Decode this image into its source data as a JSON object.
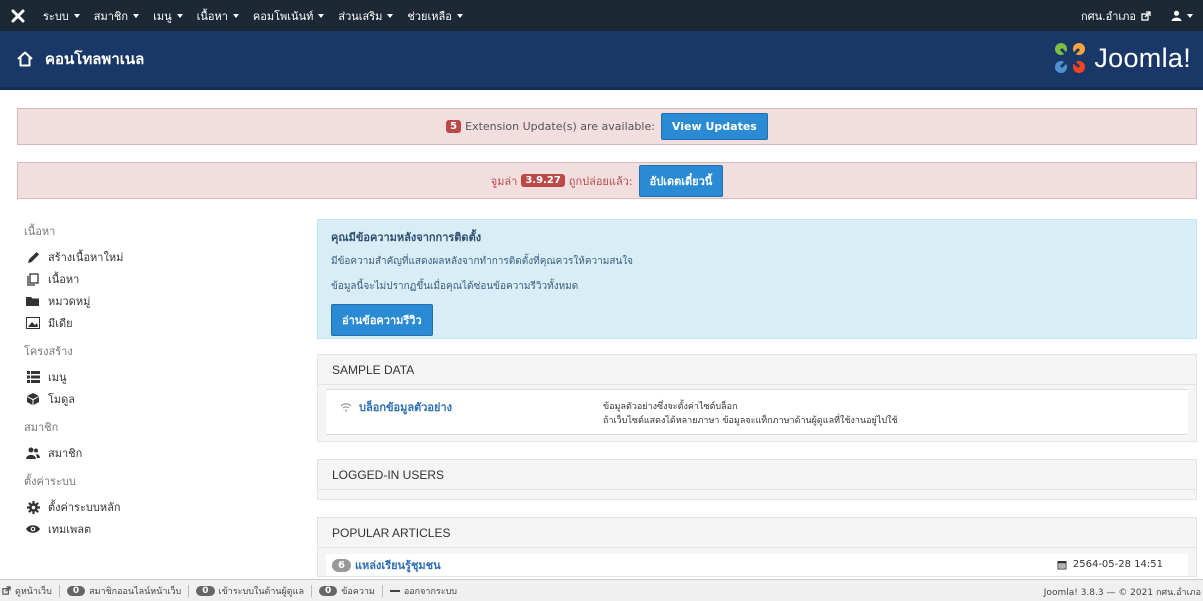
{
  "nav": {
    "menu": [
      {
        "label": "ระบบ"
      },
      {
        "label": "สมาชิก"
      },
      {
        "label": "เมนู"
      },
      {
        "label": "เนื้อหา"
      },
      {
        "label": "คอมโพเน้นท์"
      },
      {
        "label": "ส่วนเสริม"
      },
      {
        "label": "ช่วยเหลือ"
      }
    ],
    "site_link": "กศน.อำเภอ"
  },
  "header": {
    "title": "คอนโทลพาเนล",
    "brand": "Joomla!"
  },
  "alerts": {
    "extension": {
      "count": "5",
      "text": "Extension Update(s) are available:",
      "button": "View Updates"
    },
    "joomla": {
      "prefix": "จูมล่า",
      "version": "3.9.27",
      "suffix": "ถูกปล่อยแล้ว:",
      "button": "อัปเดตเดี๋ยวนี้"
    }
  },
  "sidebar": {
    "content_heading": "เนื้อหา",
    "content_items": [
      {
        "label": "สร้างเนื้อหาใหม่",
        "icon": "pencil-icon"
      },
      {
        "label": "เนื้อหา",
        "icon": "copy-icon"
      },
      {
        "label": "หมวดหมู่",
        "icon": "folder-icon"
      },
      {
        "label": "มีเดีย",
        "icon": "image-icon"
      }
    ],
    "structure_heading": "โครงสร้าง",
    "structure_items": [
      {
        "label": "เมนู",
        "icon": "list-icon"
      },
      {
        "label": "โมดูล",
        "icon": "cube-icon"
      }
    ],
    "users_heading": "สมาชิก",
    "users_items": [
      {
        "label": "สมาชิก",
        "icon": "users-icon"
      }
    ],
    "config_heading": "ตั้งค่าระบบ",
    "config_items": [
      {
        "label": "ตั้งค่าระบบหลัก",
        "icon": "gear-icon"
      },
      {
        "label": "เทมเพลต",
        "icon": "eye-icon"
      }
    ]
  },
  "postinstall": {
    "heading": "คุณมีข้อความหลังจากการติดตั้ง",
    "line1": "มีข้อความสำคัญที่แสดงผลหลังจากทำการติดตั้งที่คุณควรให้ความสนใจ",
    "line2": "ข้อมูลนี้จะไม่ปรากฏขึ้นเมื่อคุณได้ซ่อนข้อความรีวิวทั้งหมด",
    "button": "อ่านข้อความรีวิว"
  },
  "sample_data": {
    "heading": "SAMPLE DATA",
    "link": "บล็อกข้อมูลตัวอย่าง",
    "desc1": "ข้อมูลตัวอย่างซึ่งจะตั้งค่าไซต์บล็อก",
    "desc2": "ถ้าเว็บไซต์แสดงได้หลายภาษา ข้อมูลจะแท็กภาษาด้านผู้ดูแลที่ใช้งานอยู่ไปใช้"
  },
  "logged_in": {
    "heading": "LOGGED-IN USERS"
  },
  "popular": {
    "heading": "POPULAR ARTICLES",
    "rows": [
      {
        "count": "6",
        "title": "แหล่งเรียนรู้ชุมชน",
        "date": "2564-05-28 14:51"
      }
    ]
  },
  "statusbar": {
    "view_site": "ดูหน้าเว็บ",
    "visitors_count": "0",
    "visitors": "สมาชิกออนไลน์หน้าเว็บ",
    "admins_count": "0",
    "admins": "เข้าระบบในด้านผู้ดูแล",
    "messages_count": "0",
    "messages": "ข้อความ",
    "logout": "ออกจากระบบ",
    "version": "Joomla! 3.8.3 — © 2021 กศน.อำเภอ"
  }
}
